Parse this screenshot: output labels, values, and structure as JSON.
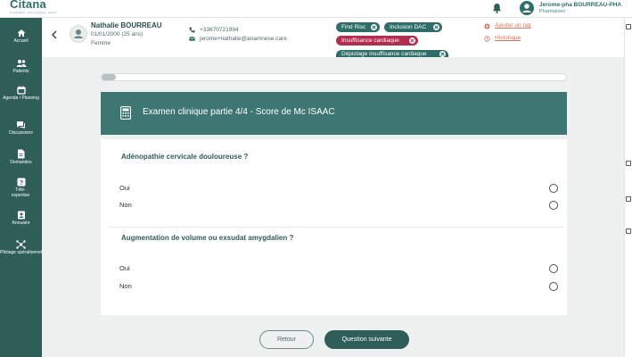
{
  "app": {
    "logo": "Citana",
    "logo_tagline": "Coordination · Communication · Patient"
  },
  "user": {
    "name": "Jerome-pha BOURREAU-PHA",
    "role": "Pharmacien"
  },
  "sidebar": {
    "items": [
      {
        "label": "Accueil",
        "icon": "home-icon"
      },
      {
        "label": "Patients",
        "icon": "people-icon"
      },
      {
        "label": "Agenda / Planning",
        "icon": "calendar-icon"
      },
      {
        "label": "Discussions",
        "icon": "chat-icon"
      },
      {
        "label": "Demandes",
        "icon": "document-icon"
      },
      {
        "label": "Télé-expertise",
        "icon": "question-icon"
      },
      {
        "label": "Annuaire",
        "icon": "directory-icon"
      },
      {
        "label": "Pilotage opérationnel",
        "icon": "hub-icon"
      }
    ]
  },
  "patient": {
    "name": "Nathalie BOURREAU",
    "dob": "01/01/2000 (25 ans)",
    "sex": "Femme",
    "phone": "+33670721994",
    "email": "jerome+nathalie@anamnese.care"
  },
  "tags": [
    {
      "label": "Find Risc",
      "color": "#2e6e68"
    },
    {
      "label": "Inclusion DAC",
      "color": "#2e6e68"
    },
    {
      "label": "Insuffisance cardiaque",
      "color": "#b32d4e"
    },
    {
      "label": "Dépistage insuffisance cardiaque",
      "color": "#2e6e68"
    }
  ],
  "actions": {
    "add_tag": "Ajouter un tag",
    "history": "Historique"
  },
  "progress": {
    "fraction": 0.03
  },
  "section": {
    "title": "Examen clinique partie 4/4 - Score de Mc ISAAC",
    "icon": "calculator-icon"
  },
  "questions": [
    {
      "text": "Adénopathie cervicale douloureuse ?",
      "options": [
        "Oui",
        "Non"
      ]
    },
    {
      "text": "Augmentation de volume ou exsudat amygdalien ?",
      "options": [
        "Oui",
        "Non"
      ]
    }
  ],
  "buttons": {
    "back": "Retour",
    "next": "Question suivante"
  },
  "colors": {
    "primary": "#2f5d58",
    "accent_link": "#e0735a",
    "tag_green": "#2e6e68",
    "tag_red": "#b32d4e",
    "background": "#eef1ef"
  }
}
